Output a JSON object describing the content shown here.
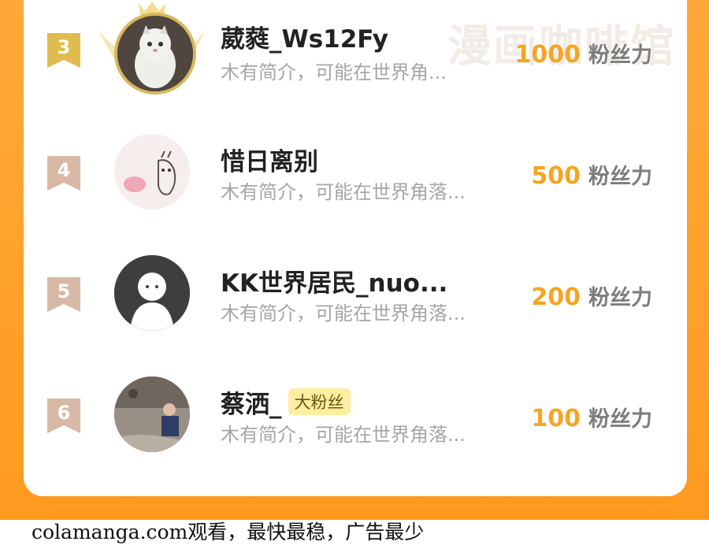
{
  "watermark": "漫画咖啡馆",
  "rows": [
    {
      "rank": "3",
      "name": "葳蕤_Ws12Fy",
      "bio": "木有简介，可能在世界角...",
      "score": "1000",
      "unit": "粉丝力",
      "badge": "",
      "medal_color": "#e7c45a"
    },
    {
      "rank": "4",
      "name": "惜日离别",
      "bio": "木有简介，可能在世界角落...",
      "score": "500",
      "unit": "粉丝力",
      "badge": "",
      "medal_color": "#d8b8a4"
    },
    {
      "rank": "5",
      "name": "KK世界居民_nuo...",
      "bio": "木有简介，可能在世界角落...",
      "score": "200",
      "unit": "粉丝力",
      "badge": "",
      "medal_color": "#d8b8a4"
    },
    {
      "rank": "6",
      "name": "蔡洒_",
      "bio": "木有简介，可能在世界角落...",
      "score": "100",
      "unit": "粉丝力",
      "badge": "大粉丝",
      "medal_color": "#d8b8a4"
    }
  ],
  "footer": "colamanga.com观看，最快最稳，广告最少",
  "colors": {
    "frame": "#ff9a1f",
    "score": "#f4a623",
    "badge_bg": "#fdeea0"
  }
}
